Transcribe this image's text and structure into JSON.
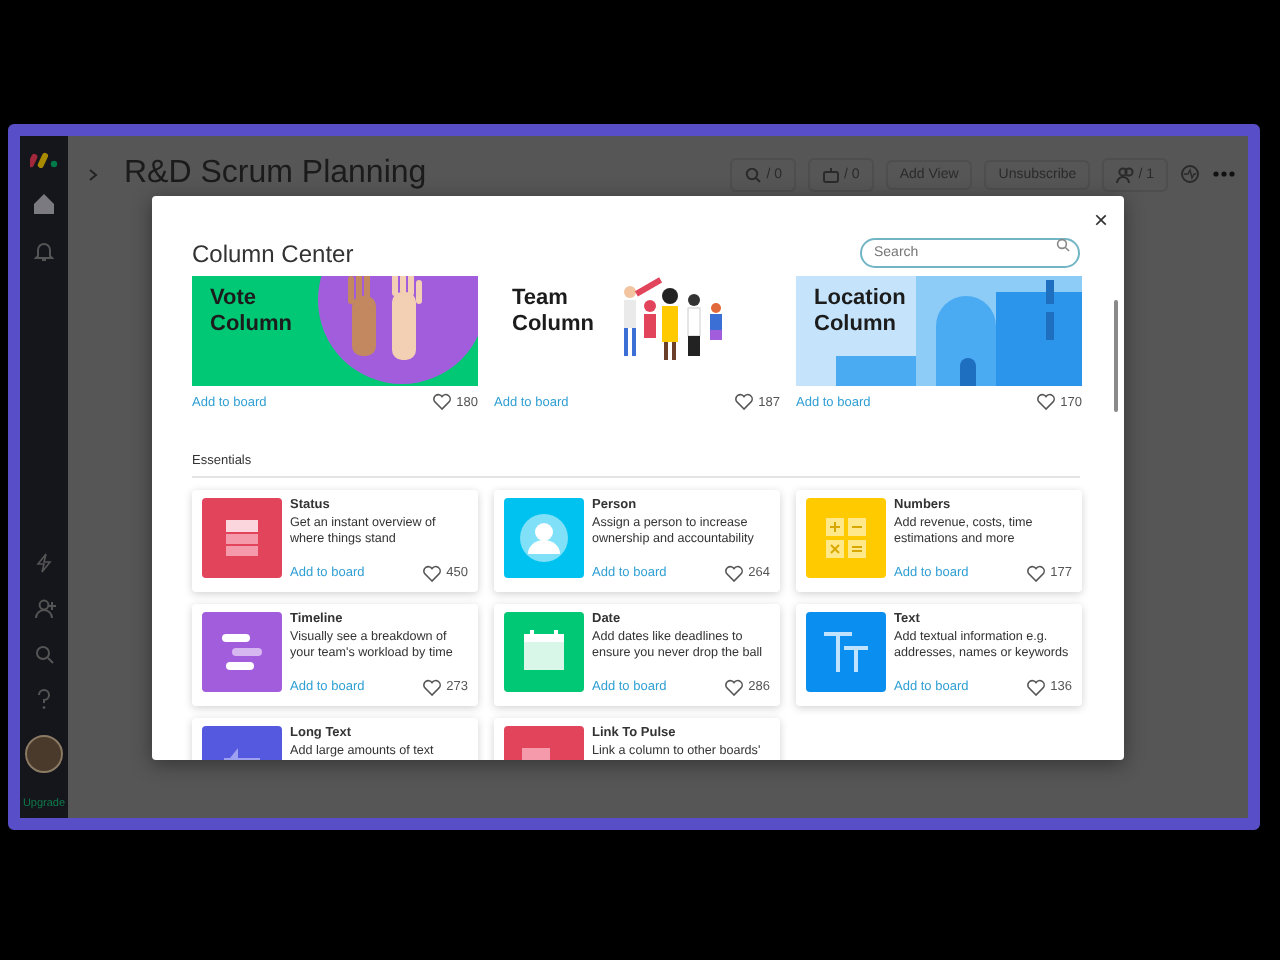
{
  "app": {
    "board_title": "R&D Scrum Planning",
    "header_items": [
      {
        "kind": "search",
        "label": "/ 0"
      },
      {
        "kind": "robot",
        "label": "/ 0"
      },
      {
        "kind": "plain",
        "label": "Add View"
      },
      {
        "kind": "plain",
        "label": "Unsubscribe"
      },
      {
        "kind": "people",
        "label": "/ 1"
      },
      {
        "kind": "activity"
      },
      {
        "kind": "more"
      }
    ]
  },
  "sidebar": {
    "upgrade_label": "Upgrade"
  },
  "modal": {
    "close_glyph": "×",
    "title": "Column Center",
    "search": {
      "placeholder": "Search"
    },
    "featured": [
      {
        "kind": "vote",
        "title": "Vote Column",
        "link": "Add to board",
        "likes": "180"
      },
      {
        "kind": "team",
        "title": "Team Column",
        "link": "Add to board",
        "likes": "187"
      },
      {
        "kind": "location",
        "title": "Location Column",
        "link": "Add to board",
        "likes": "170"
      }
    ],
    "section": {
      "title": "Essentials",
      "columns": [
        {
          "kind": "status",
          "name": "Status",
          "description": "Get an instant overview of where things stand",
          "link": "Add to board",
          "likes": "450"
        },
        {
          "kind": "person",
          "name": "Person",
          "description": "Assign a person to increase ownership and accountability",
          "link": "Add to board",
          "likes": "264"
        },
        {
          "kind": "numbers",
          "name": "Numbers",
          "description": "Add revenue, costs, time estimations and more",
          "link": "Add to board",
          "likes": "177"
        },
        {
          "kind": "timeline",
          "name": "Timeline",
          "description": "Visually see a breakdown of your team's workload by time",
          "link": "Add to board",
          "likes": "273"
        },
        {
          "kind": "date",
          "name": "Date",
          "description": "Add dates like deadlines to ensure you never drop the ball",
          "link": "Add to board",
          "likes": "286"
        },
        {
          "kind": "text",
          "name": "Text",
          "description": "Add textual information e.g. addresses, names or keywords",
          "link": "Add to board",
          "likes": "136"
        },
        {
          "kind": "long_text",
          "name": "Long Text",
          "description": "Add large amounts of text"
        },
        {
          "kind": "link",
          "name": "Link To Pulse",
          "description": "Link a column to other boards'"
        }
      ]
    }
  }
}
